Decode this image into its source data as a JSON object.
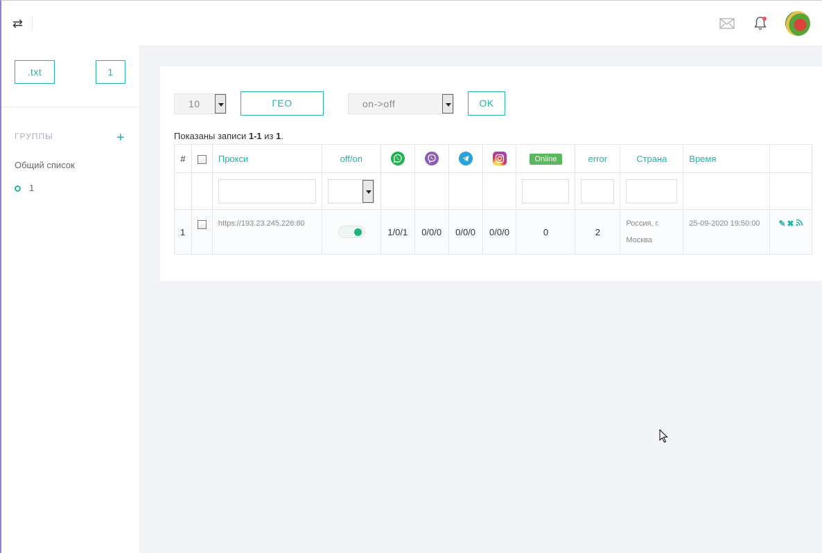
{
  "sidebar": {
    "export_button": ".txt",
    "count_button": "1",
    "groups_label": "ГРУППЫ",
    "add_group": "+",
    "general_list": "Общий список",
    "list_item": "1"
  },
  "toolbar": {
    "per_page": "10",
    "geo_button": "ГЕО",
    "status_filter": "on->off",
    "ok_button": "OK"
  },
  "summary": {
    "prefix": "Показаны записи",
    "range": "1-1",
    "of": "из",
    "total": "1",
    "suffix": "."
  },
  "table": {
    "headers": {
      "num": "#",
      "proxy": "Прокси",
      "offon": "off/on",
      "whatsapp": "whatsapp-icon",
      "viber": "viber-icon",
      "telegram": "telegram-icon",
      "instagram": "instagram-icon",
      "online": "Online",
      "error": "error",
      "country": "Страна",
      "time": "Время"
    },
    "rows": [
      {
        "num": "1",
        "proxy": "https://193.23.245.226:80",
        "whatsapp": "1/0/1",
        "viber": "0/0/0",
        "telegram": "0/0/0",
        "instagram": "0/0/0",
        "online": "0",
        "error": "2",
        "country_line1": "Россия, г.",
        "country_line2": "Москва",
        "time": "25-09-2020 19:50:00",
        "enabled": true
      }
    ]
  },
  "colors": {
    "accent": "#22b5a8",
    "online_badge": "#5cb85c",
    "sidebar_border": "#8a7fe0"
  }
}
